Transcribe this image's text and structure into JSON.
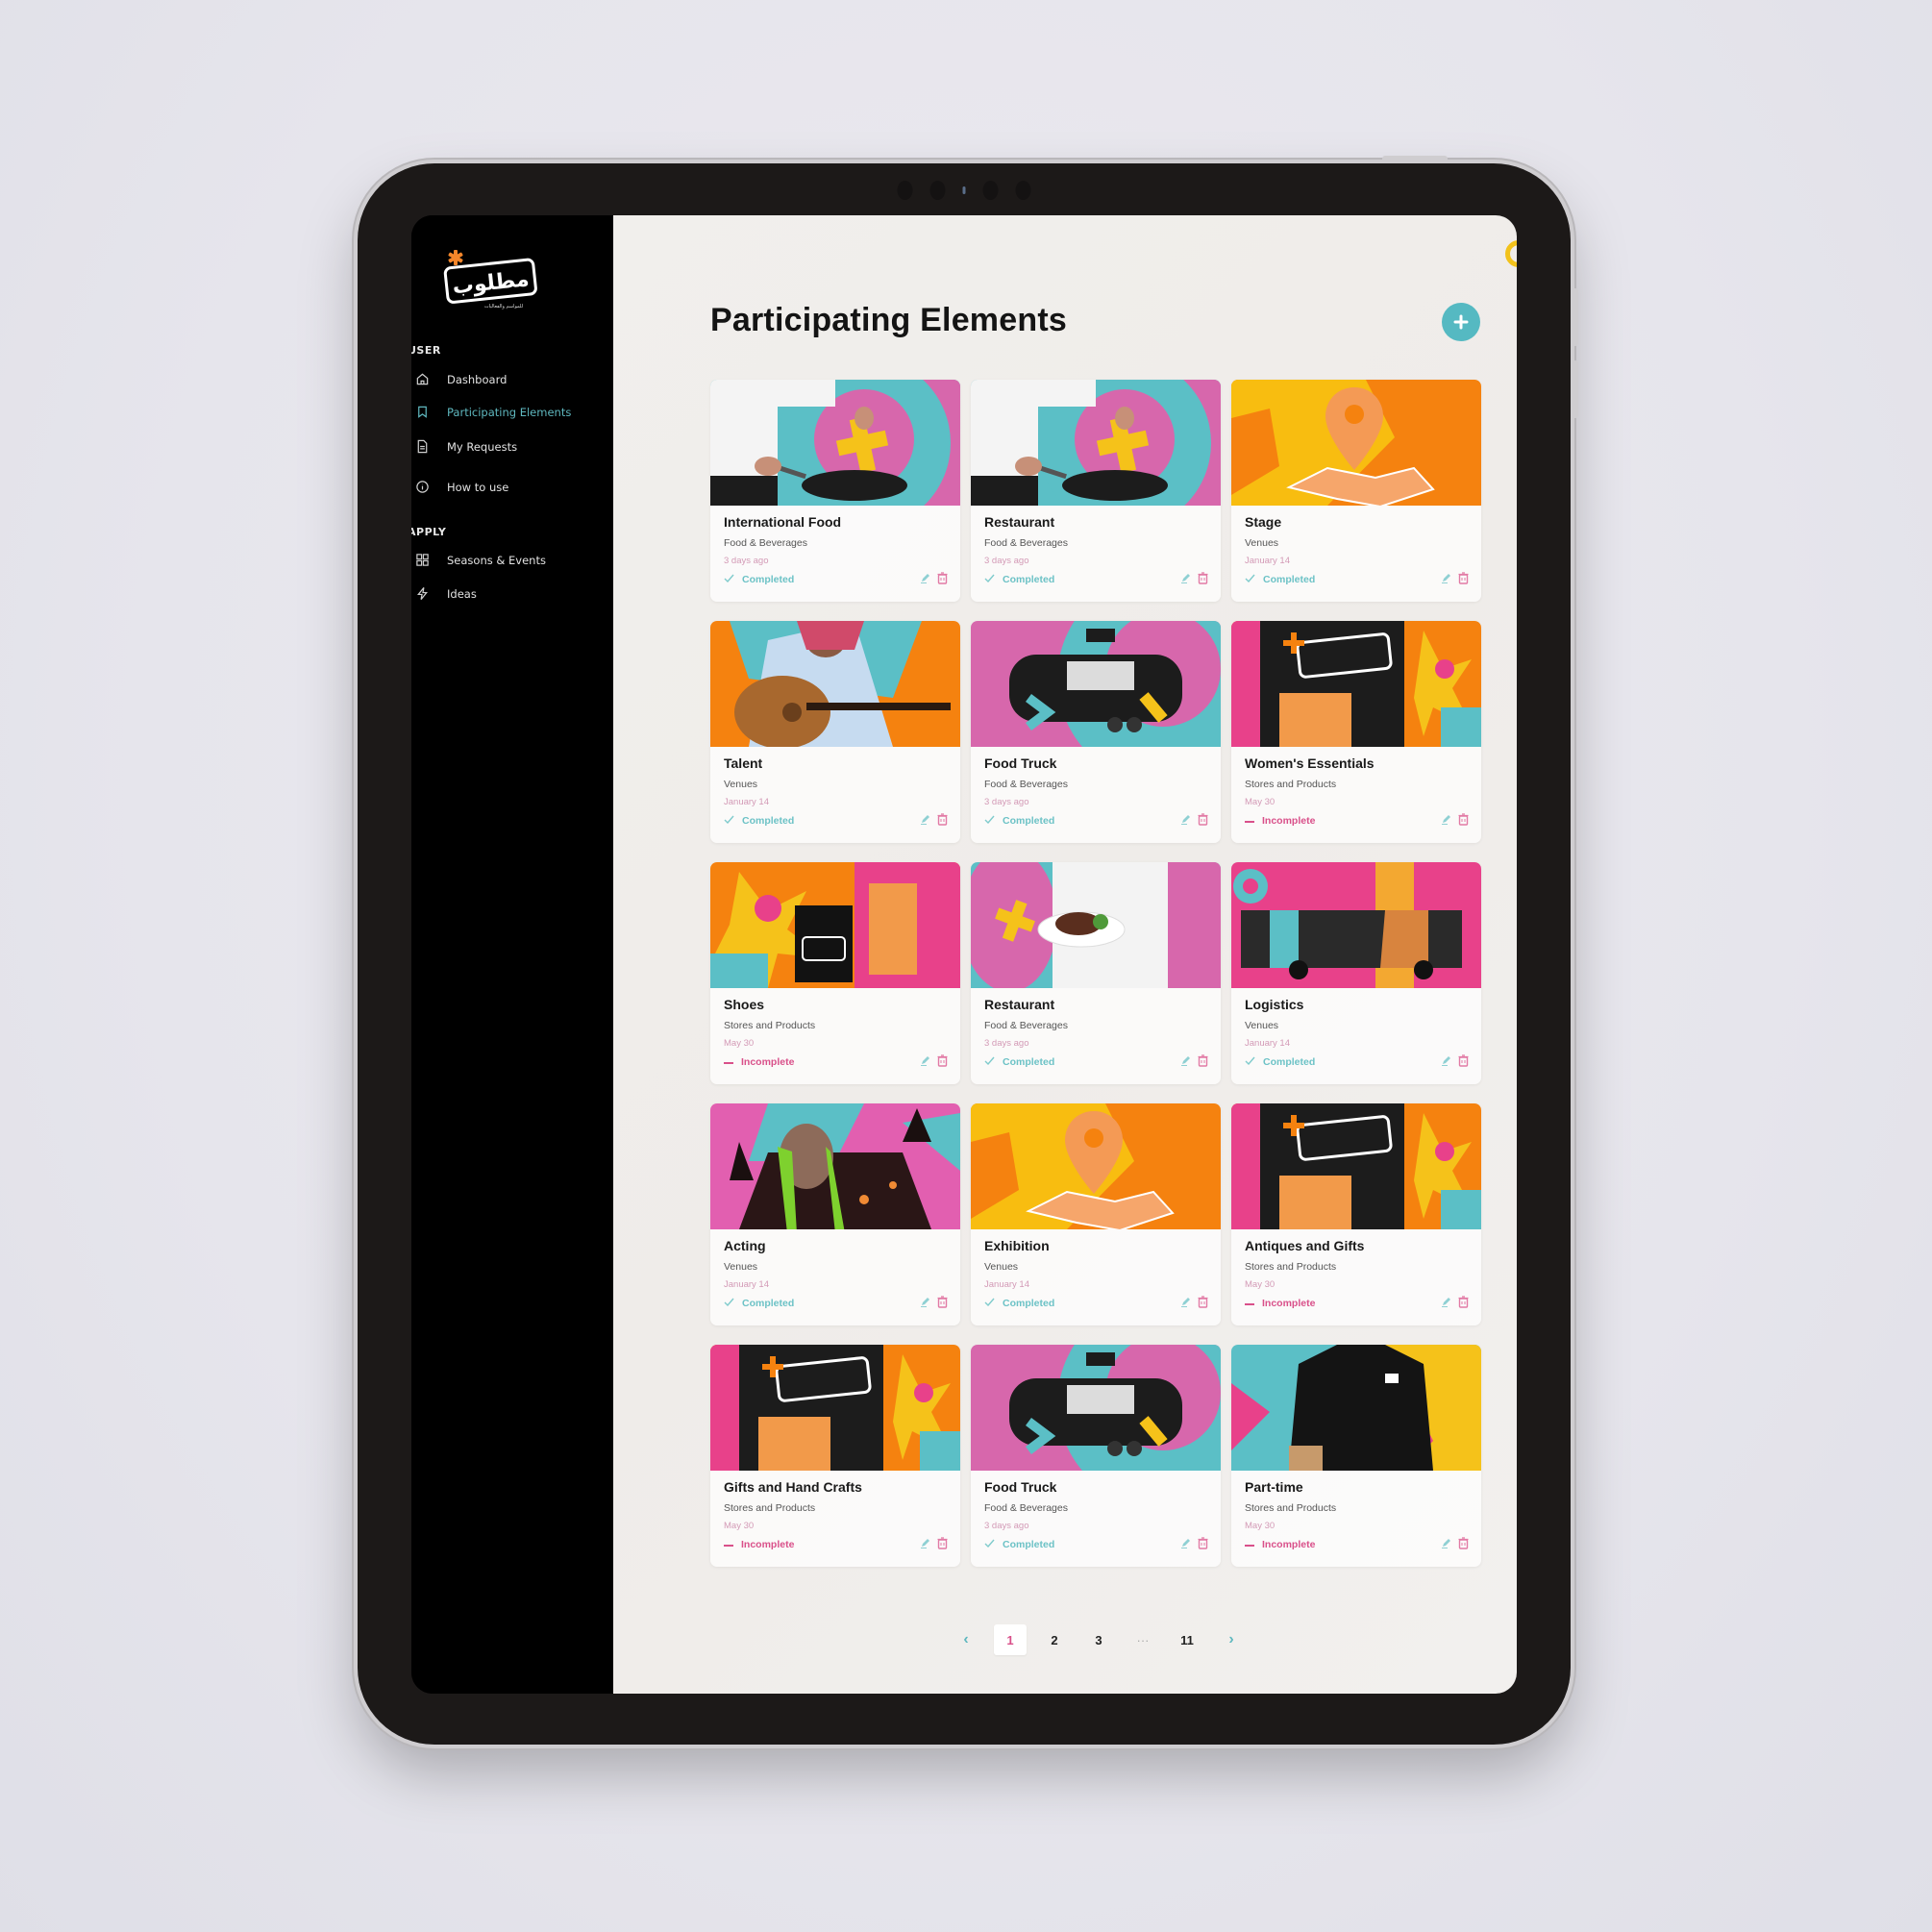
{
  "app": {
    "brand_asterisk_color": "#f5862a",
    "accent_color": "#55b9c2",
    "incomplete_color": "#d9508a"
  },
  "sidebar": {
    "sections": [
      {
        "label": "USER",
        "items": [
          {
            "label": "Dashboard",
            "icon": "home-icon",
            "active": false
          },
          {
            "label": "Participating Elements",
            "icon": "bookmark-icon",
            "active": true
          },
          {
            "label": "My Requests",
            "icon": "document-icon",
            "active": false
          },
          {
            "label": "How to use",
            "icon": "info-icon",
            "active": false
          }
        ]
      },
      {
        "label": "APPLY",
        "items": [
          {
            "label": "Seasons & Events",
            "icon": "grid-icon",
            "active": false
          },
          {
            "label": "Ideas",
            "icon": "lightning-icon",
            "active": false
          }
        ]
      }
    ]
  },
  "header": {
    "title": "Participating Elements",
    "add_button": "+"
  },
  "cards": [
    {
      "title": "International Food",
      "category": "Food & Beverages",
      "date": "3 days ago",
      "status": "Completed",
      "image": "chef-pan"
    },
    {
      "title": "Restaurant",
      "category": "Food & Beverages",
      "date": "3 days ago",
      "status": "Completed",
      "image": "chef-pan"
    },
    {
      "title": "Stage",
      "category": "Venues",
      "date": "January 14",
      "status": "Completed",
      "image": "map-pin"
    },
    {
      "title": "Talent",
      "category": "Venues",
      "date": "January 14",
      "status": "Completed",
      "image": "oud-player"
    },
    {
      "title": "Food Truck",
      "category": "Food & Beverages",
      "date": "3 days ago",
      "status": "Completed",
      "image": "food-truck"
    },
    {
      "title": "Women's Essentials",
      "category": "Stores and Products",
      "date": "May 30",
      "status": "Incomplete",
      "image": "booth"
    },
    {
      "title": "Shoes",
      "category": "Stores and Products",
      "date": "May 30",
      "status": "Incomplete",
      "image": "shopping-bags"
    },
    {
      "title": "Restaurant",
      "category": "Food & Beverages",
      "date": "3 days ago",
      "status": "Completed",
      "image": "waiter-plate"
    },
    {
      "title": "Logistics",
      "category": "Venues",
      "date": "January 14",
      "status": "Completed",
      "image": "bus"
    },
    {
      "title": "Acting",
      "category": "Venues",
      "date": "January 14",
      "status": "Completed",
      "image": "costume"
    },
    {
      "title": "Exhibition",
      "category": "Venues",
      "date": "January 14",
      "status": "Completed",
      "image": "map-pin"
    },
    {
      "title": "Antiques and Gifts",
      "category": "Stores and Products",
      "date": "May 30",
      "status": "Incomplete",
      "image": "booth"
    },
    {
      "title": "Gifts and Hand Crafts",
      "category": "Stores and Products",
      "date": "May 30",
      "status": "Incomplete",
      "image": "booth"
    },
    {
      "title": "Food Truck",
      "category": "Food & Beverages",
      "date": "3 days ago",
      "status": "Completed",
      "image": "food-truck"
    },
    {
      "title": "Part-time",
      "category": "Stores and Products",
      "date": "May 30",
      "status": "Incomplete",
      "image": "tshirt-man"
    }
  ],
  "pagination": {
    "prev": "‹",
    "pages": [
      "1",
      "2",
      "3",
      "···",
      "11"
    ],
    "current": "1",
    "next": "›"
  }
}
